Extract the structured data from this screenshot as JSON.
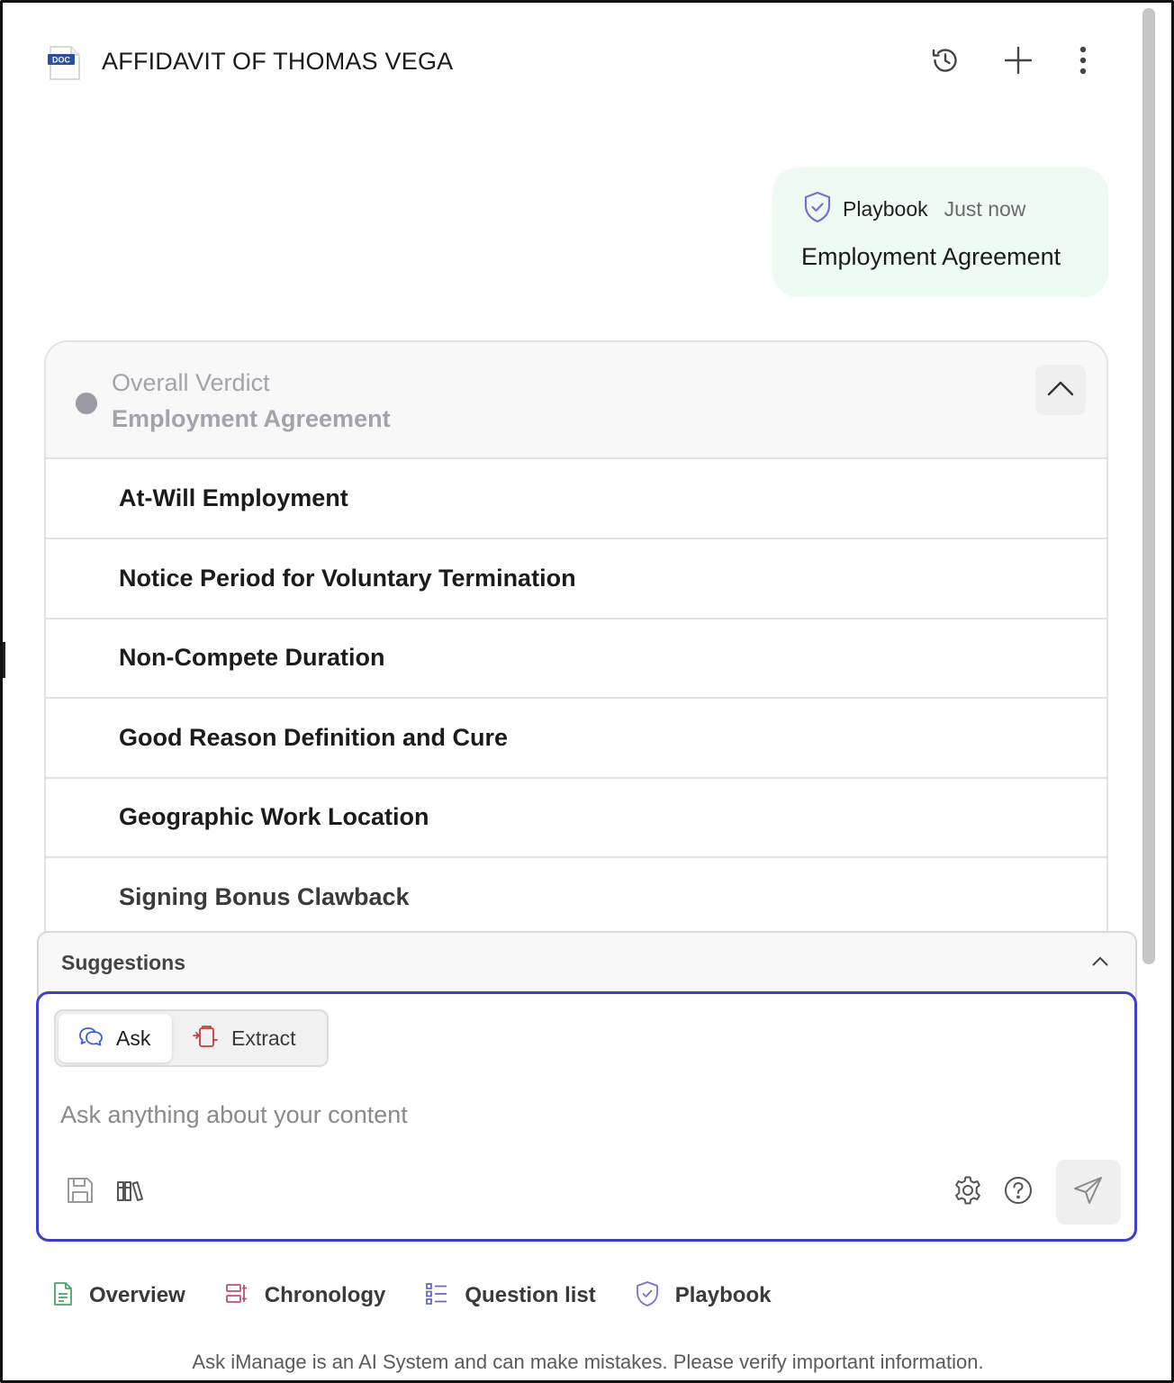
{
  "header": {
    "doc_badge": "DOC",
    "title": "AFFIDAVIT OF THOMAS VEGA",
    "history_icon": "history-icon",
    "add_icon": "plus-icon",
    "menu_icon": "more-vertical-icon"
  },
  "message": {
    "icon": "shield-check-icon",
    "title": "Playbook",
    "time": "Just now",
    "body": "Employment Agreement"
  },
  "verdict": {
    "label": "Overall Verdict",
    "subtitle": "Employment Agreement",
    "status_color": "#9b9ba6",
    "items": [
      {
        "label": "At-Will Employment"
      },
      {
        "label": "Notice Period for Voluntary Termination"
      },
      {
        "label": "Non-Compete Duration"
      },
      {
        "label": "Good Reason Definition and Cure"
      },
      {
        "label": "Geographic Work Location"
      },
      {
        "label": "Signing Bonus Clawback"
      }
    ]
  },
  "suggestions": {
    "label": "Suggestions"
  },
  "composer": {
    "modes": [
      {
        "label": "Ask",
        "icon": "chat-bubbles-icon",
        "selected": true
      },
      {
        "label": "Extract",
        "icon": "extract-icon",
        "selected": false
      }
    ],
    "placeholder": "Ask anything about your content",
    "accent_color": "#3f3fcf"
  },
  "tabs": [
    {
      "label": "Overview",
      "icon": "document-icon"
    },
    {
      "label": "Chronology",
      "icon": "chronology-icon"
    },
    {
      "label": "Question list",
      "icon": "list-icon"
    },
    {
      "label": "Playbook",
      "icon": "shield-check-icon"
    }
  ],
  "disclaimer": "Ask iManage is an AI System and can make mistakes. Please verify important information."
}
